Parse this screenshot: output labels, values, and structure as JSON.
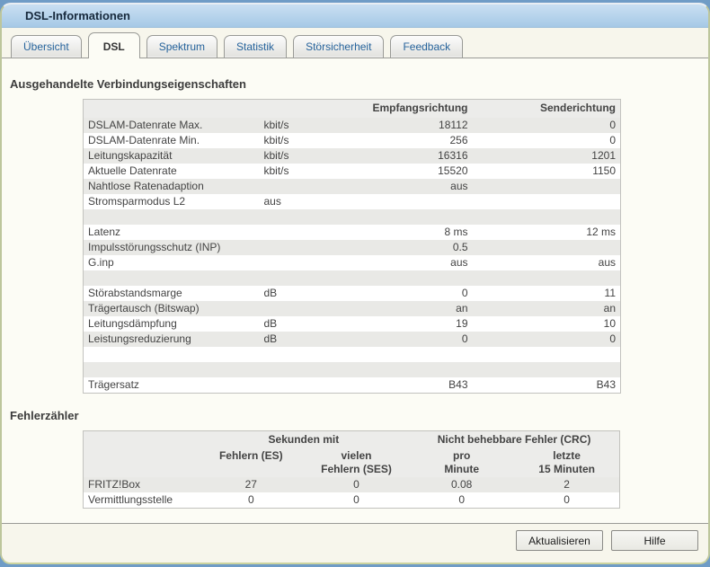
{
  "window": {
    "title": "DSL-Informationen"
  },
  "tabs": [
    {
      "label": "Übersicht",
      "active": false
    },
    {
      "label": "DSL",
      "active": true
    },
    {
      "label": "Spektrum",
      "active": false
    },
    {
      "label": "Statistik",
      "active": false
    },
    {
      "label": "Störsicherheit",
      "active": false
    },
    {
      "label": "Feedback",
      "active": false
    }
  ],
  "connection_section": {
    "title": "Ausgehandelte Verbindungseigenschaften",
    "col_receive": "Empfangsrichtung",
    "col_send": "Senderichtung",
    "rows": [
      {
        "label": "DSLAM-Datenrate Max.",
        "unit": "kbit/s",
        "receive": "18112",
        "send": "0"
      },
      {
        "label": "DSLAM-Datenrate Min.",
        "unit": "kbit/s",
        "receive": "256",
        "send": "0"
      },
      {
        "label": "Leitungskapazität",
        "unit": "kbit/s",
        "receive": "16316",
        "send": "1201"
      },
      {
        "label": "Aktuelle Datenrate",
        "unit": "kbit/s",
        "receive": "15520",
        "send": "1150"
      },
      {
        "label": "Nahtlose Ratenadaption",
        "unit": "",
        "receive": "aus",
        "send": ""
      },
      {
        "label": "Stromsparmodus L2",
        "unit": "aus",
        "receive": "",
        "send": ""
      },
      {
        "label": "",
        "unit": "",
        "receive": "",
        "send": ""
      },
      {
        "label": "Latenz",
        "unit": "",
        "receive": "8 ms",
        "send": "12 ms"
      },
      {
        "label": "Impulsstörungsschutz (INP)",
        "unit": "",
        "receive": "0.5",
        "send": ""
      },
      {
        "label": "G.inp",
        "unit": "",
        "receive": "aus",
        "send": "aus"
      },
      {
        "label": "",
        "unit": "",
        "receive": "",
        "send": ""
      },
      {
        "label": "Störabstandsmarge",
        "unit": "dB",
        "receive": "0",
        "send": "11"
      },
      {
        "label": "Trägertausch (Bitswap)",
        "unit": "",
        "receive": "an",
        "send": "an"
      },
      {
        "label": "Leitungsdämpfung",
        "unit": "dB",
        "receive": "19",
        "send": "10"
      },
      {
        "label": "Leistungsreduzierung",
        "unit": "dB",
        "receive": "0",
        "send": "0"
      },
      {
        "label": "",
        "unit": "",
        "receive": "",
        "send": ""
      },
      {
        "label": "",
        "unit": "",
        "receive": "",
        "send": ""
      },
      {
        "label": "Trägersatz",
        "unit": "",
        "receive": "B43",
        "send": "B43"
      }
    ]
  },
  "error_section": {
    "title": "Fehlerzähler",
    "group_seconds": "Sekunden mit",
    "group_crc": "Nicht behebbare Fehler (CRC)",
    "col_es": "Fehlern (ES)",
    "col_ses": "vielen\nFehlern (SES)",
    "col_per_minute": "pro\nMinute",
    "col_last15": "letzte\n15 Minuten",
    "rows": [
      {
        "label": "FRITZ!Box",
        "values": [
          "27",
          "0",
          "0.08",
          "2"
        ]
      },
      {
        "label": "Vermittlungsstelle",
        "values": [
          "0",
          "0",
          "0",
          "0"
        ]
      }
    ]
  },
  "footer": {
    "refresh_label": "Aktualisieren",
    "help_label": "Hilfe"
  },
  "colors": {
    "page_background_blue": "#6f9cc6",
    "titlebar_blue_top": "#c9dff2",
    "titlebar_blue_bottom": "#a6c9e6",
    "tab_text_blue": "#26639c",
    "panel_background": "#fcfcf5",
    "row_stripe_gray": "#e9e9e6",
    "table_header_gray": "#ececea"
  }
}
